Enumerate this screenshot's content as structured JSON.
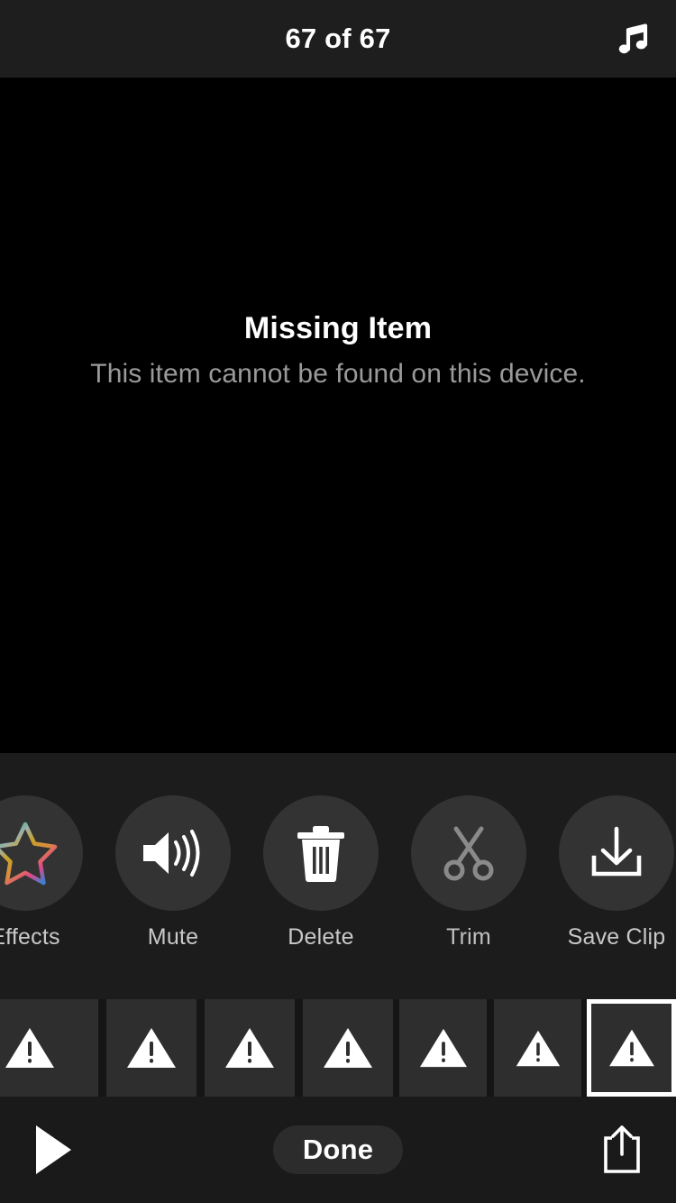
{
  "topbar": {
    "counter": "67 of 67",
    "music_icon": "music-note-icon"
  },
  "stage": {
    "title": "Missing Item",
    "subtitle": "This item cannot be found on this device.",
    "background_color": "#000000"
  },
  "toolbar": {
    "background_color": "#1c1c1c",
    "circle_color": "#333333",
    "items": [
      {
        "label": "Effects",
        "icon": "star-icon",
        "state": "enabled",
        "icon_color": "gradient"
      },
      {
        "label": "Mute",
        "icon": "speaker-wave-icon",
        "state": "enabled",
        "icon_color": "#ffffff"
      },
      {
        "label": "Delete",
        "icon": "trash-icon",
        "state": "enabled",
        "icon_color": "#ffffff"
      },
      {
        "label": "Trim",
        "icon": "scissors-icon",
        "state": "disabled",
        "icon_color": "#8a8a8a"
      },
      {
        "label": "Save Clip",
        "icon": "download-icon",
        "state": "enabled",
        "icon_color": "#ffffff"
      }
    ],
    "effects_gradient": [
      "#27b58a",
      "#b0b0b0",
      "#c9a227",
      "#e0478a",
      "#3f7fd0"
    ]
  },
  "filmstrip": {
    "background_color": "#151515",
    "frame_color": "#2e2e2e",
    "selected_border_color": "#ffffff",
    "frames": [
      {
        "icon": "warning-triangle-icon",
        "selected": false
      },
      {
        "icon": "warning-triangle-icon",
        "selected": false
      },
      {
        "icon": "warning-triangle-icon",
        "selected": false
      },
      {
        "icon": "warning-triangle-icon",
        "selected": false
      },
      {
        "icon": "warning-triangle-icon",
        "selected": false
      },
      {
        "icon": "warning-triangle-icon",
        "selected": false
      },
      {
        "icon": "warning-triangle-icon",
        "selected": true
      }
    ]
  },
  "bottombar": {
    "background_color": "#1a1a1a",
    "play_icon": "play-icon",
    "done_label": "Done",
    "share_icon": "share-icon"
  }
}
